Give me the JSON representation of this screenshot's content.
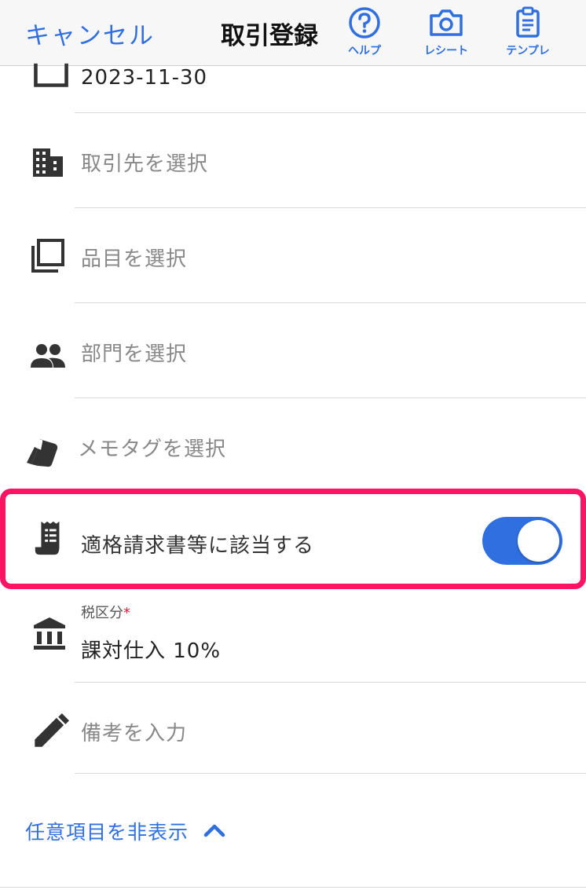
{
  "header": {
    "cancel_label": "キャンセル",
    "title": "取引登録",
    "help_label": "ヘルプ",
    "receipt_label": "レシート",
    "template_label": "テンプレ"
  },
  "form": {
    "date_value": "2023-11-30",
    "partner_placeholder": "取引先を選択",
    "item_placeholder": "品目を選択",
    "department_placeholder": "部門を選択",
    "memo_tag_placeholder": "メモタグを選択",
    "invoice_label": "適格請求書等に該当する",
    "invoice_toggle_on": true,
    "tax_label": "税区分",
    "tax_required_mark": "*",
    "tax_value": "課対仕入 10%",
    "remarks_placeholder": "備考を入力",
    "optional_toggle_label": "任意項目を非表示"
  },
  "colors": {
    "accent": "#2f6fe0",
    "highlight": "#ff1463",
    "required": "#e0203a"
  },
  "icons": {
    "help": "help-circle-icon",
    "receipt": "camera-icon",
    "template": "clipboard-icon",
    "date": "calendar-icon",
    "partner": "building-icon",
    "item": "copy-stack-icon",
    "department": "people-icon",
    "memo_tag": "tag-icon",
    "invoice": "receipt-icon",
    "tax": "bank-icon",
    "remarks": "pencil-icon",
    "collapse": "chevron-up-icon"
  }
}
